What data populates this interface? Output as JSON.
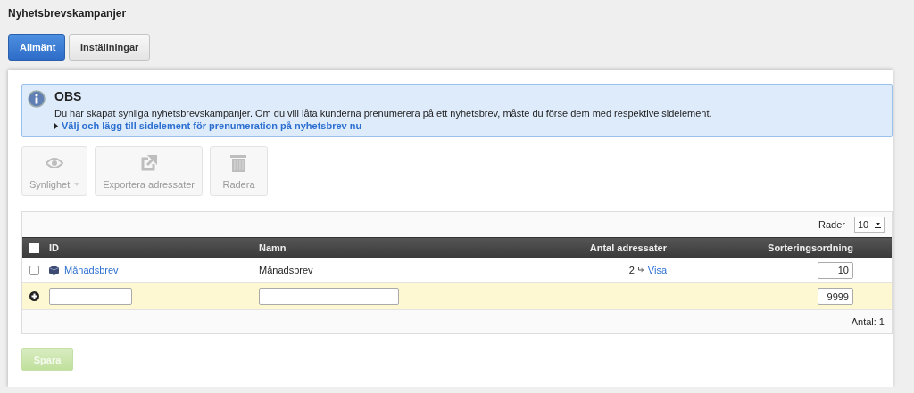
{
  "page_title": "Nyhetsbrevskampanjer",
  "tabs": [
    {
      "label": "Allmänt",
      "selected": true
    },
    {
      "label": "Inställningar",
      "selected": false
    }
  ],
  "notice": {
    "title": "OBS",
    "text": "Du har skapat synliga nyhetsbrevskampanjer. Om du vill låta kunderna prenumerera på ett nyhetsbrev, måste du förse dem med respektive sidelement.",
    "link": "Välj och lägg till sidelement för prenumeration på nyhetsbrev nu"
  },
  "toolbar": [
    {
      "kind": "visibility",
      "label": "Synlighet",
      "disabled": true
    },
    {
      "kind": "export",
      "label": "Exportera adressater",
      "disabled": true
    },
    {
      "kind": "delete",
      "label": "Radera",
      "disabled": true
    }
  ],
  "table": {
    "rows_label": "Rader",
    "rows_per_page": "10",
    "select_all_checked": false,
    "columns": [
      "ID",
      "Namn",
      "Antal adressater",
      "Sorteringsordning"
    ],
    "rows": [
      {
        "checked": false,
        "id": "Månadsbrev",
        "name": "Månadsbrev",
        "recipients": "2",
        "view_link": "Visa",
        "sort_order": "10"
      }
    ],
    "new_row": {
      "sort_order": "9999"
    },
    "count": "Antal: 1"
  },
  "save_button": {
    "label": "Spara",
    "disabled": true
  }
}
